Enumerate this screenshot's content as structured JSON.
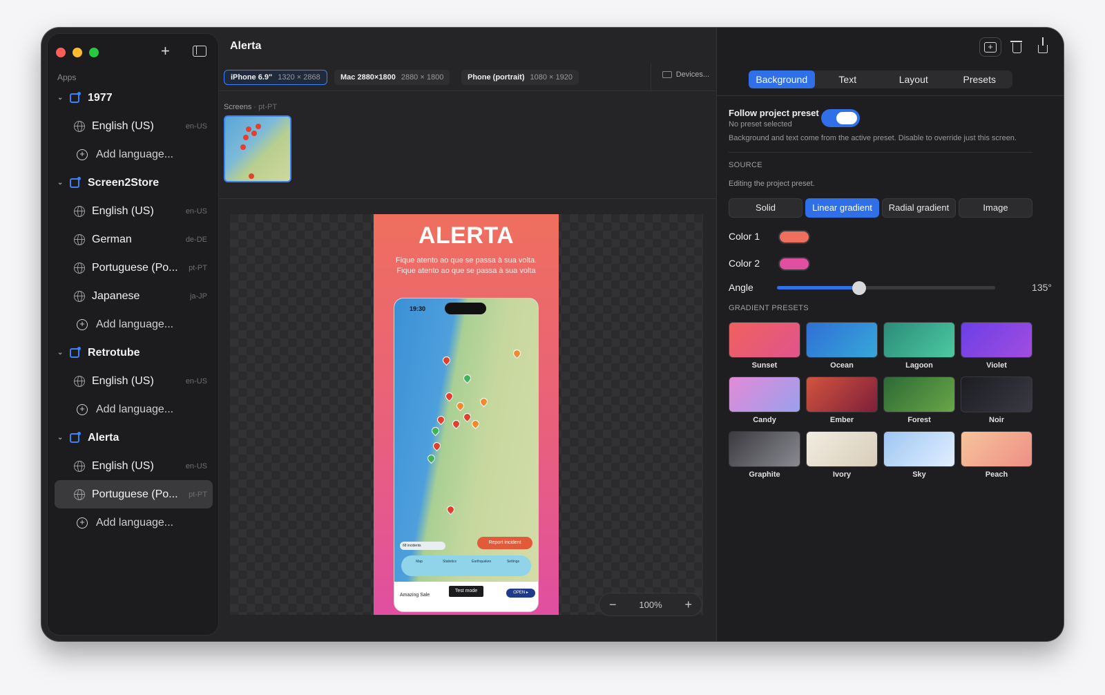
{
  "sidebar": {
    "apps_label": "Apps",
    "apps": [
      {
        "name": "1977",
        "languages": [
          {
            "name": "English (US)",
            "code": "en-US"
          }
        ],
        "add_label": "Add language..."
      },
      {
        "name": "Screen2Store",
        "languages": [
          {
            "name": "English (US)",
            "code": "en-US"
          },
          {
            "name": "German",
            "code": "de-DE"
          },
          {
            "name": "Portuguese (Po...",
            "code": "pt-PT"
          },
          {
            "name": "Japanese",
            "code": "ja-JP"
          }
        ],
        "add_label": "Add language..."
      },
      {
        "name": "Retrotube",
        "languages": [
          {
            "name": "English (US)",
            "code": "en-US"
          }
        ],
        "add_label": "Add language..."
      },
      {
        "name": "Alerta",
        "languages": [
          {
            "name": "English (US)",
            "code": "en-US"
          },
          {
            "name": "Portuguese (Po...",
            "code": "pt-PT",
            "selected": true
          }
        ],
        "add_label": "Add language..."
      }
    ]
  },
  "header": {
    "title": "Alerta"
  },
  "devices": [
    {
      "name": "iPhone 6.9\"",
      "size": "1320 × 2868",
      "active": true
    },
    {
      "name": "Mac 2880×1800",
      "size": "2880 × 1800"
    },
    {
      "name": "Phone (portrait)",
      "size": "1080 × 1920"
    }
  ],
  "devices_button": "Devices...",
  "screens": {
    "label": "Screens",
    "locale": "pt-PT"
  },
  "artboard": {
    "title": "ALERTA",
    "subtitle": "Fique atento ao que se passa à sua volta.\nFique atento ao que se passa à sua volta",
    "phone_time": "19:30",
    "report_button": "Report incident",
    "incidents": "68 incidents",
    "tabs": [
      "Map",
      "Statistics",
      "Earthquakes",
      "Settings"
    ],
    "ad_title": "Amazing Sale",
    "test_mode": "Test mode",
    "open": "OPEN ▸"
  },
  "zoom": {
    "minus": "−",
    "value": "100%",
    "plus": "+"
  },
  "panel": {
    "tabs": [
      "Background",
      "Text",
      "Layout",
      "Presets"
    ],
    "follow_title": "Follow project preset",
    "follow_sub": "No preset selected",
    "follow_desc": "Background and text come from the active preset. Disable to override just this screen.",
    "follow_on": true,
    "source_label": "SOURCE",
    "editing": "Editing the project preset.",
    "source_options": [
      "Solid",
      "Linear gradient",
      "Radial gradient",
      "Image"
    ],
    "source_selected": "Linear gradient",
    "color1_label": "Color 1",
    "color1": "#ef6f5e",
    "color2_label": "Color 2",
    "color2": "#e04fa0",
    "angle_label": "Angle",
    "angle_value": "135°",
    "angle_fraction": 0.375,
    "presets_label": "GRADIENT PRESETS",
    "presets": [
      {
        "name": "Sunset",
        "from": "#f0605e",
        "to": "#e0558c"
      },
      {
        "name": "Ocean",
        "from": "#2f6fd6",
        "to": "#36a8d8"
      },
      {
        "name": "Lagoon",
        "from": "#2c8b7a",
        "to": "#4ccaa0"
      },
      {
        "name": "Violet",
        "from": "#6b3fe6",
        "to": "#a24de0"
      },
      {
        "name": "Candy",
        "from": "#e38ad6",
        "to": "#9aa0ee"
      },
      {
        "name": "Ember",
        "from": "#d2543e",
        "to": "#7e1f3a"
      },
      {
        "name": "Forest",
        "from": "#2d6a35",
        "to": "#6aa648"
      },
      {
        "name": "Noir",
        "from": "#1c1c22",
        "to": "#3a3a44"
      },
      {
        "name": "Graphite",
        "from": "#3a3a3f",
        "to": "#8a8a92"
      },
      {
        "name": "Ivory",
        "from": "#f2ede2",
        "to": "#d8cdb8"
      },
      {
        "name": "Sky",
        "from": "#9ec6f2",
        "to": "#e2efff"
      },
      {
        "name": "Peach",
        "from": "#f6c49a",
        "to": "#ee8f86"
      }
    ]
  }
}
